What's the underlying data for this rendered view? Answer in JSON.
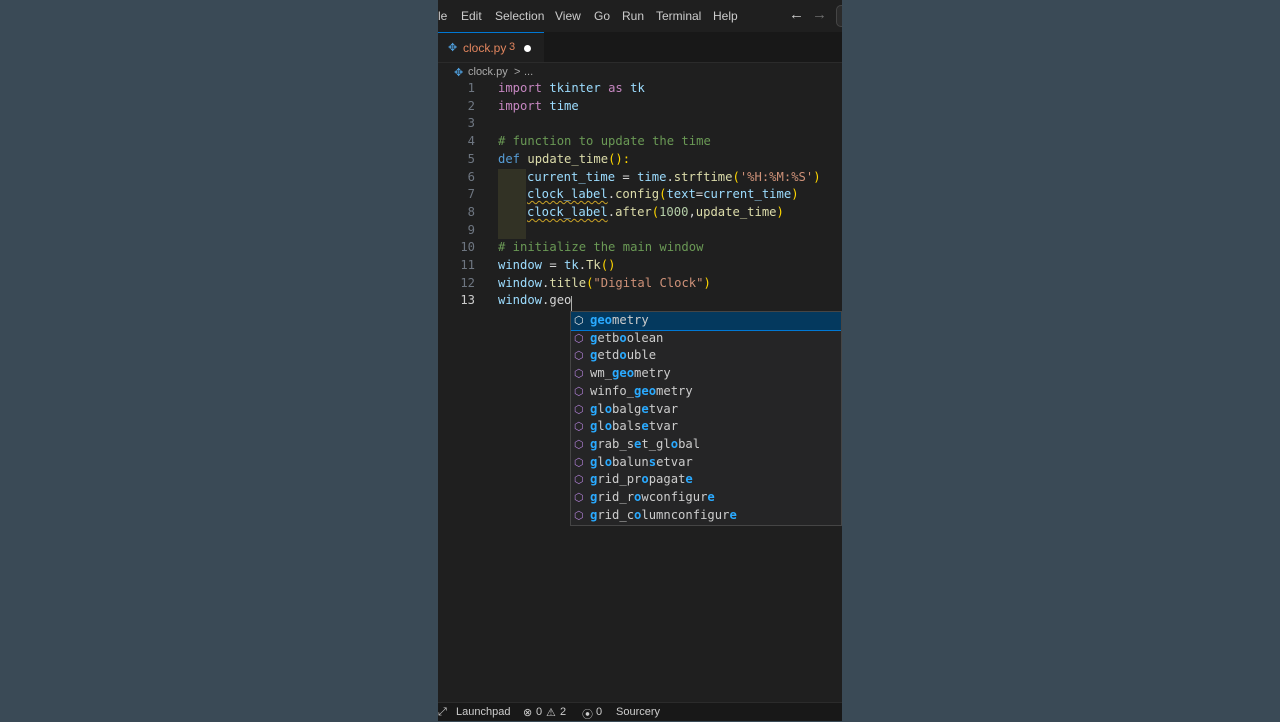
{
  "menubar": {
    "items": [
      "le",
      "Edit",
      "Selection",
      "View",
      "Go",
      "Run",
      "Terminal",
      "Help"
    ],
    "back_icon": "arrow-left-icon",
    "forward_icon": "arrow-right-icon"
  },
  "tab": {
    "name": "clock.py",
    "problem_count": "3",
    "modified_icon": "dot-icon",
    "file_icon": "python-icon"
  },
  "breadcrumb": {
    "file": "clock.py",
    "sep": ">",
    "more": "..."
  },
  "editor": {
    "line_numbers": [
      "1",
      "2",
      "3",
      "4",
      "5",
      "6",
      "7",
      "8",
      "9",
      "10",
      "11",
      "12",
      "13"
    ],
    "active_line": "13",
    "lines": {
      "l1": {
        "t1": "import",
        "t2": " tkinter ",
        "t3": "as",
        "t4": " tk"
      },
      "l2": {
        "t1": "import",
        "t2": " time"
      },
      "l4": {
        "t1": "# function to update the time"
      },
      "l5": {
        "t1": "def",
        "t2": " ",
        "t3": "update_time",
        "t4": "():"
      },
      "l6": {
        "t1": "current_time",
        "t2": " = ",
        "t3": "time",
        "t4": ".",
        "t5": "strftime",
        "t6": "(",
        "t7": "'%H:%M:%S'",
        "t8": ")"
      },
      "l7": {
        "t1": "clock_label",
        "t2": ".",
        "t3": "config",
        "t4": "(",
        "t5": "text",
        "t6": "=",
        "t7": "current_time",
        "t8": ")"
      },
      "l8": {
        "t1": "clock_label",
        "t2": ".",
        "t3": "after",
        "t4": "(",
        "t5": "1000",
        "t6": ",",
        "t7": "update_time",
        "t8": ")"
      },
      "l10": {
        "t1": "# initialize the main window"
      },
      "l11": {
        "t1": "window",
        "t2": " = ",
        "t3": "tk",
        "t4": ".",
        "t5": "Tk",
        "t6": "()"
      },
      "l12": {
        "t1": "window",
        "t2": ".",
        "t3": "title",
        "t4": "(",
        "t5": "\"Digital Clock\"",
        "t6": ")"
      },
      "l13": {
        "t1": "window",
        "t2": ".geo"
      }
    }
  },
  "suggestions": [
    {
      "pre": "",
      "hl": "geo",
      "post": "metry"
    },
    {
      "pre": "",
      "hl": "g",
      "post": "etb",
      "hl2": "o",
      "post2": "olean"
    },
    {
      "pre": "",
      "hl": "g",
      "post": "etd",
      "hl2": "o",
      "post2": "uble"
    },
    {
      "pre": "wm_",
      "hl": "geo",
      "post": "metry"
    },
    {
      "pre": "winfo_",
      "hl": "geo",
      "post": "metry"
    },
    {
      "pre": "",
      "hl": "g",
      "post": "l",
      "hl2": "o",
      "post2": "balg",
      "hl3": "e",
      "post3": "tvar"
    },
    {
      "pre": "",
      "hl": "g",
      "post": "l",
      "hl2": "o",
      "post2": "bals",
      "hl3": "e",
      "post3": "tvar"
    },
    {
      "pre": "",
      "hl": "g",
      "post": "rab_s",
      "hl2": "e",
      "post2": "t_gl",
      "hl3": "o",
      "post3": "bal"
    },
    {
      "pre": "",
      "hl": "g",
      "post": "l",
      "hl2": "o",
      "post2": "balun",
      "hl3": "s",
      "post3": "etvar"
    },
    {
      "pre": "",
      "hl": "g",
      "post": "rid_pr",
      "hl2": "o",
      "post2": "pagat",
      "hl3": "e",
      "post3": ""
    },
    {
      "pre": "",
      "hl": "g",
      "post": "rid_r",
      "hl2": "o",
      "post2": "wconfigur",
      "hl3": "e",
      "post3": ""
    },
    {
      "pre": "",
      "hl": "g",
      "post": "rid_c",
      "hl2": "o",
      "post2": "lumnconfigur",
      "hl3": "e",
      "post3": ""
    }
  ],
  "suggest_icon": "method-cube-icon",
  "statusbar": {
    "launchpad": "Launchpad",
    "errors": "0",
    "warnings": "2",
    "ports": "0",
    "sourcery": "Sourcery"
  }
}
